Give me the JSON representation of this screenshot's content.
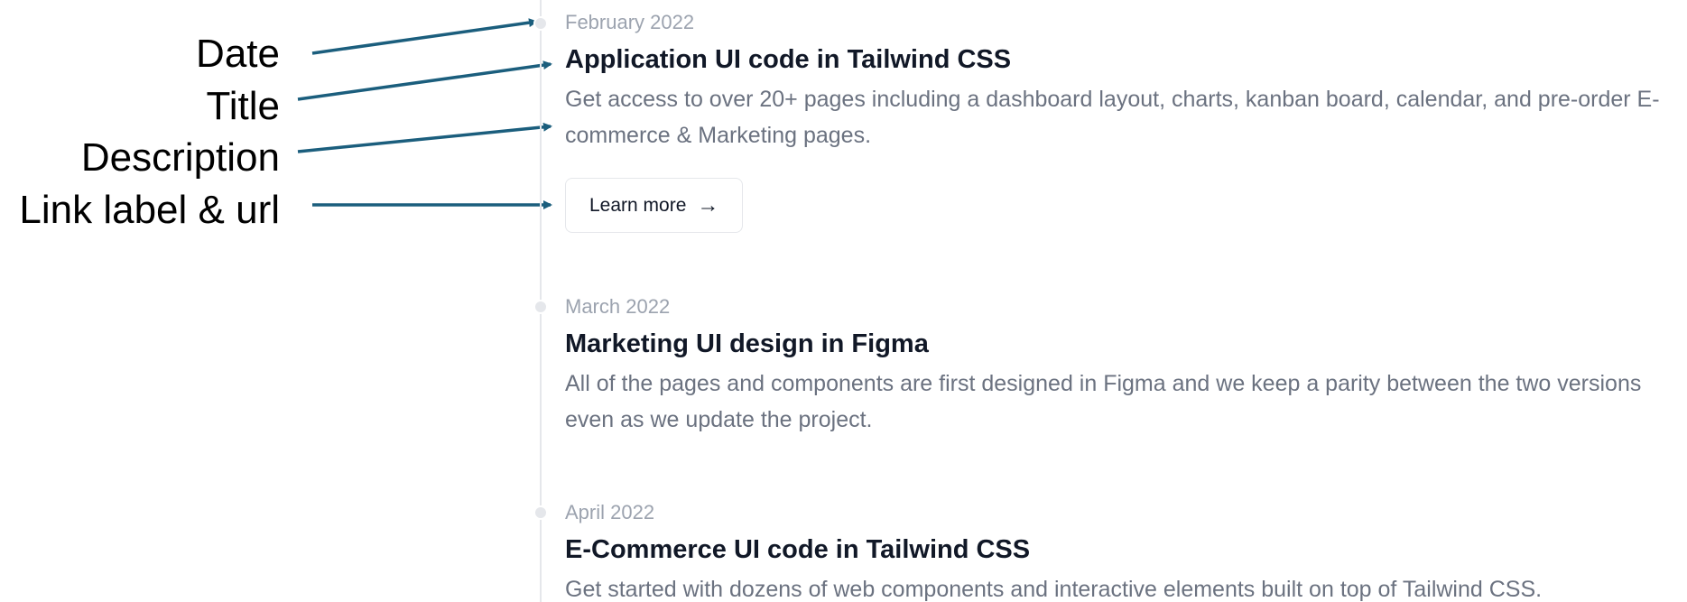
{
  "annotations": {
    "date_label": "Date",
    "title_label": "Title",
    "description_label": "Description",
    "link_label": "Link label & url",
    "arrow_color": "#1b5e7d"
  },
  "timeline": {
    "items": [
      {
        "date": "February 2022",
        "title": "Application UI code in Tailwind CSS",
        "description": "Get access to over 20+ pages including a dashboard layout, charts, kanban board, calendar, and pre-order E-commerce & Marketing pages.",
        "link_label": "Learn more",
        "link_icon": "arrow-right-icon"
      },
      {
        "date": "March 2022",
        "title": "Marketing UI design in Figma",
        "description": "All of the pages and components are first designed in Figma and we keep a parity between the two versions even as we update the project."
      },
      {
        "date": "April 2022",
        "title": "E-Commerce UI code in Tailwind CSS",
        "description": "Get started with dozens of web components and interactive elements built on top of Tailwind CSS."
      }
    ]
  }
}
